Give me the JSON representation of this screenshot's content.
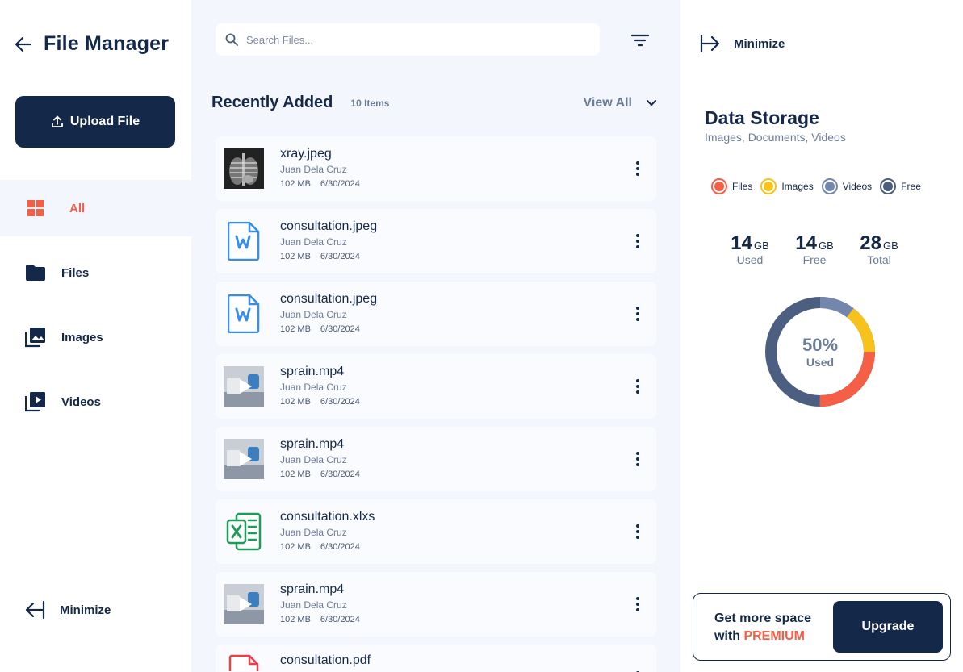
{
  "sidebar": {
    "title": "File Manager",
    "upload_label": "Upload File",
    "nav": [
      {
        "label": "All",
        "icon": "grid-icon"
      },
      {
        "label": "Files",
        "icon": "folder-icon"
      },
      {
        "label": "Images",
        "icon": "images-icon"
      },
      {
        "label": "Videos",
        "icon": "video-icon"
      }
    ],
    "minimize_label": "Minimize"
  },
  "main": {
    "search_placeholder": "Search Files...",
    "section_title": "Recently Added",
    "item_count": "10 Items",
    "view_all": "View All",
    "files": [
      {
        "name": "xray.jpeg",
        "owner": "Juan Dela Cruz",
        "size": "102 MB",
        "date": "6/30/2024",
        "kind": "xray-thumbnail"
      },
      {
        "name": "consultation.jpeg",
        "owner": "Juan Dela Cruz",
        "size": "102 MB",
        "date": "6/30/2024",
        "kind": "word-document-icon"
      },
      {
        "name": "consultation.jpeg",
        "owner": "Juan Dela Cruz",
        "size": "102 MB",
        "date": "6/30/2024",
        "kind": "word-document-icon"
      },
      {
        "name": "sprain.mp4",
        "owner": "Juan Dela Cruz",
        "size": "102 MB",
        "date": "6/30/2024",
        "kind": "video-thumbnail"
      },
      {
        "name": "sprain.mp4",
        "owner": "Juan Dela Cruz",
        "size": "102 MB",
        "date": "6/30/2024",
        "kind": "video-thumbnail"
      },
      {
        "name": "consultation.xlxs",
        "owner": "Juan Dela Cruz",
        "size": "102 MB",
        "date": "6/30/2024",
        "kind": "excel-document-icon"
      },
      {
        "name": "sprain.mp4",
        "owner": "Juan Dela Cruz",
        "size": "102 MB",
        "date": "6/30/2024",
        "kind": "video-thumbnail"
      },
      {
        "name": "consultation.pdf",
        "owner": "",
        "size": "",
        "date": "",
        "kind": "pdf-document-icon"
      }
    ]
  },
  "right": {
    "minimize_label": "Minimize",
    "title": "Data Storage",
    "subtitle": "Images, Documents, Videos",
    "legend": [
      {
        "label": "Files",
        "color": "#f45f45"
      },
      {
        "label": "Images",
        "color": "#f7c21c"
      },
      {
        "label": "Videos",
        "color": "#7387ad"
      },
      {
        "label": "Free",
        "color": "#4d5f80"
      }
    ],
    "stats": [
      {
        "value": "14",
        "unit": "GB",
        "label": "Used"
      },
      {
        "value": "14",
        "unit": "GB",
        "label": "Free"
      },
      {
        "value": "28",
        "unit": "GB",
        "label": "Total"
      }
    ],
    "donut": {
      "percent_label": "50%",
      "label": "Used"
    },
    "upgrade": {
      "line1": "Get more space",
      "line2_prefix": "with",
      "premium": "PREMIUM",
      "button": "Upgrade"
    }
  }
}
